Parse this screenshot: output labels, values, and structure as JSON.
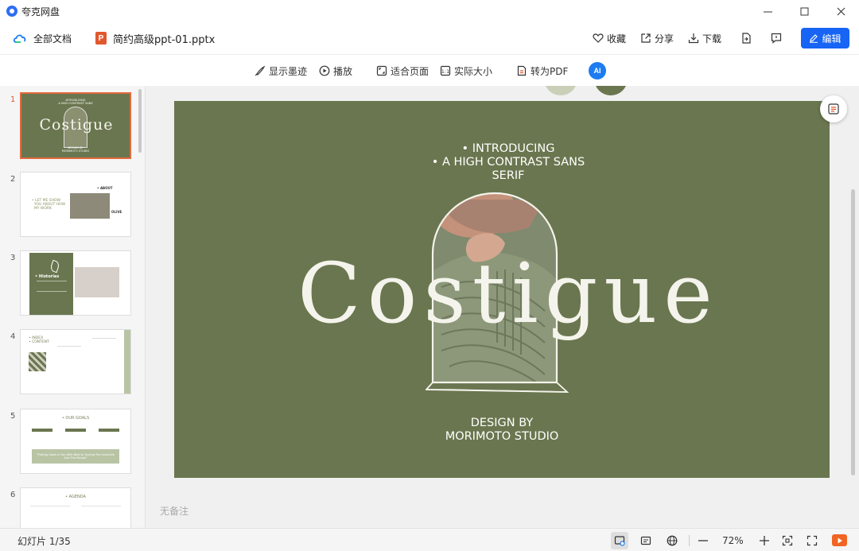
{
  "app": {
    "name": "夸克网盘"
  },
  "window": {
    "minimize_icon": "minimize-icon",
    "maximize_icon": "maximize-icon",
    "close_icon": "close-icon"
  },
  "docbar": {
    "root_label": "全部文档",
    "file_name": "简约高级ppt-01.pptx",
    "file_type_badge": "P",
    "favorite_label": "收藏",
    "share_label": "分享",
    "download_label": "下载",
    "edit_label": "编辑"
  },
  "toolbar": {
    "show_ink_label": "显示墨迹",
    "play_label": "播放",
    "fit_page_label": "适合页面",
    "actual_size_label": "实际大小",
    "to_pdf_label": "转为PDF",
    "ai_badge": "AI"
  },
  "thumbnails": [
    {
      "number": "1",
      "title": "Costigue",
      "sub_top": "INTRODUCING\nA HIGH CONTRAST SANS",
      "sub_bottom": "DESIGN BY\nMORIMOTO STUDIO"
    },
    {
      "number": "2",
      "text_a": "• LET ME SHOW\n  YOU ABOUT HOW\n  MY WORK",
      "text_b": "• ABOUT",
      "text_c": "OLIVE"
    },
    {
      "number": "3",
      "text_a": "• Histories"
    },
    {
      "number": "4",
      "text_a": "• INDEX\n• CONTENT"
    },
    {
      "number": "5",
      "text_a": "• OUR GOALS",
      "quote": "\"Putting Goals in You With Best to Turning The Inventive And The Simple\""
    },
    {
      "number": "6",
      "text_a": "• AGENDA"
    }
  ],
  "slide": {
    "intro_line1": "•  INTRODUCING",
    "intro_line2": "•  A HIGH CONTRAST SANS",
    "intro_line3": "SERIF",
    "title": "Costigue",
    "footer_line1": "DESIGN BY",
    "footer_line2": "MORIMOTO STUDIO",
    "background_color": "#6a764f"
  },
  "notes_placeholder": "无备注",
  "statusbar": {
    "slide_count": "幻灯片 1/35",
    "zoom": "72%"
  },
  "colors": {
    "accent": "#1764f5",
    "active_thumb_border": "#e36b3c",
    "present": "#f06424"
  }
}
